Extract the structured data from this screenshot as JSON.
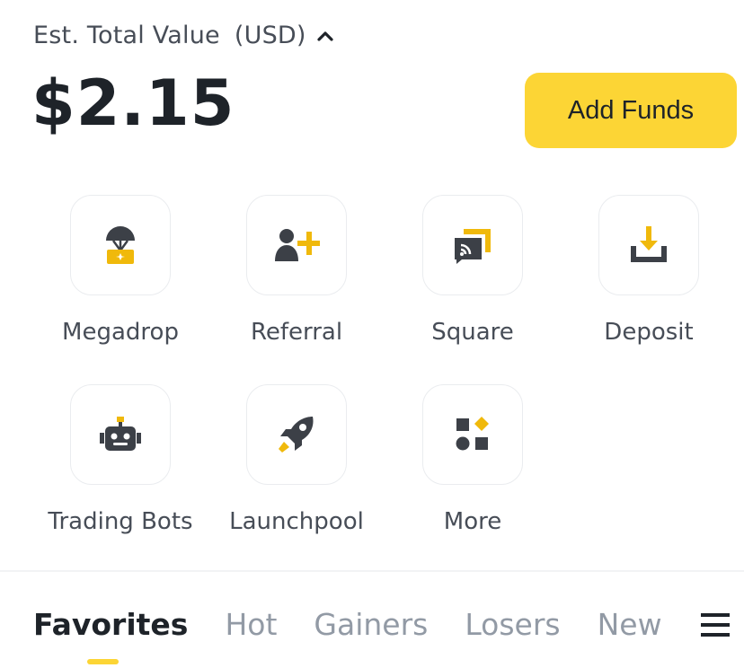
{
  "header": {
    "label": "Est. Total Value",
    "currency": "(USD)",
    "caret_icon": "chevron-up-icon",
    "balance": "$2.15",
    "add_funds_label": "Add Funds"
  },
  "shortcuts": [
    {
      "label": "Megadrop",
      "icon": "megadrop-icon"
    },
    {
      "label": "Referral",
      "icon": "referral-icon"
    },
    {
      "label": "Square",
      "icon": "square-icon"
    },
    {
      "label": "Deposit",
      "icon": "deposit-icon"
    },
    {
      "label": "Trading Bots",
      "icon": "trading-bots-icon"
    },
    {
      "label": "Launchpool",
      "icon": "launchpool-icon"
    },
    {
      "label": "More",
      "icon": "more-icon"
    }
  ],
  "market_tabs": {
    "items": [
      "Favorites",
      "Hot",
      "Gainers",
      "Losers",
      "New"
    ],
    "active": "Favorites",
    "menu_icon": "hamburger-menu-icon"
  },
  "colors": {
    "accent": "#fcd535",
    "text_primary": "#1e2329",
    "text_secondary": "#474d57",
    "text_muted": "#929aa5",
    "icon_dark": "#3c4047"
  }
}
